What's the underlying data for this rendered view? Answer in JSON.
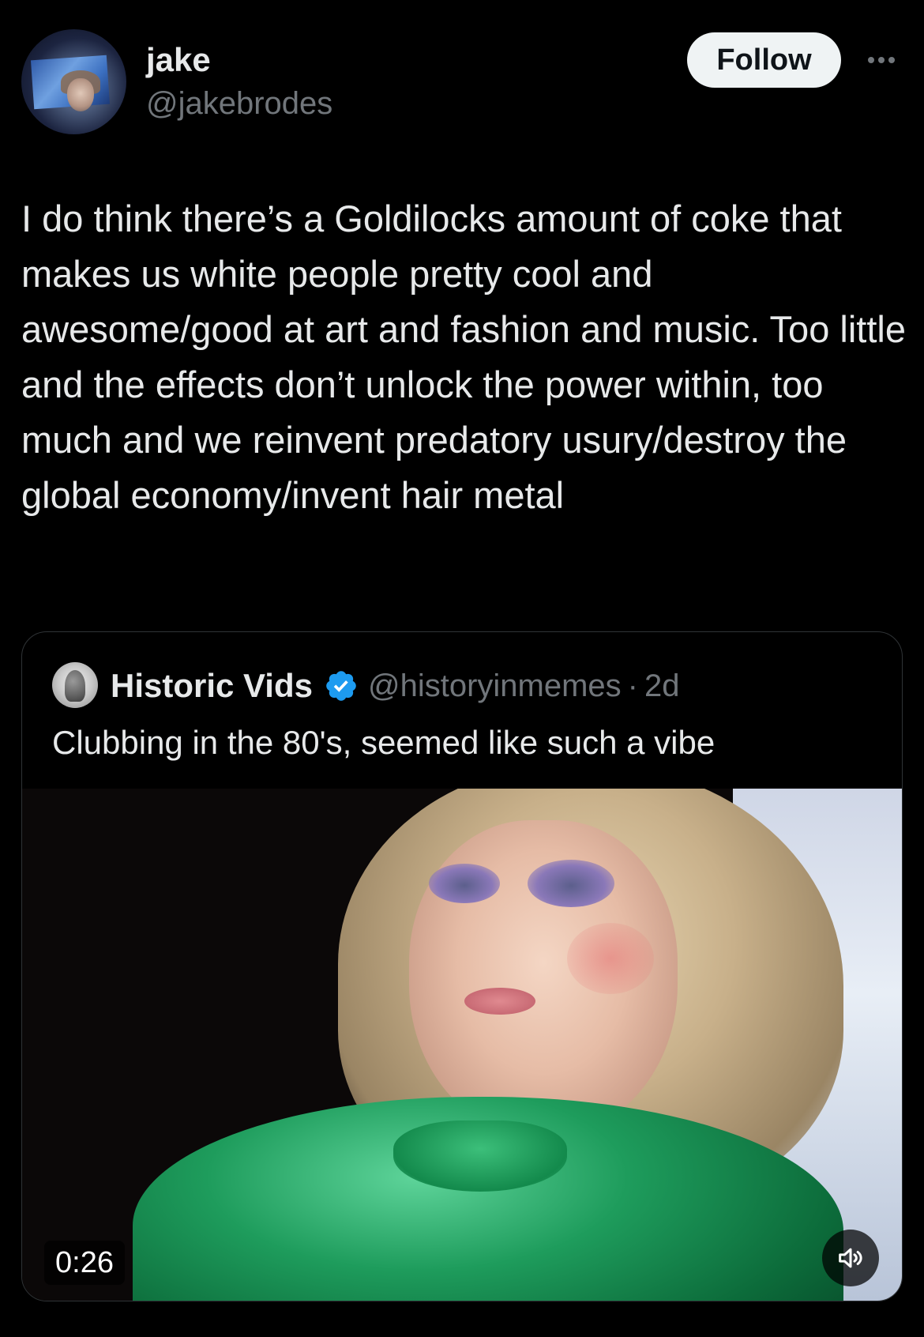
{
  "author": {
    "display_name": "jake",
    "handle": "@jakebrodes",
    "avatar_icon": "user-avatar"
  },
  "actions": {
    "follow_label": "Follow",
    "more_icon": "more-horizontal-icon"
  },
  "tweet": {
    "text": "I do think there’s a Goldilocks amount of coke that makes us white people pretty cool and awesome/good at art and fashion and music. Too little and the effects don’t unlock the power within, too much and we reinvent predatory usury/destroy the global economy/invent hair metal"
  },
  "quoted_tweet": {
    "display_name": "Historic Vids",
    "verified_icon": "verified-badge-icon",
    "verified_color": "#1d9bf0",
    "handle": "@historyinmemes",
    "separator": "·",
    "time_ago": "2d",
    "text": "Clubbing in the 80's, seemed like such a vibe",
    "video": {
      "duration": "0:26",
      "volume_icon": "volume-muted-icon"
    }
  },
  "colors": {
    "background": "#000000",
    "primary_text": "#e7e9ea",
    "secondary_text": "#71767b",
    "border": "#2f3336",
    "follow_button_bg": "#eff3f4",
    "follow_button_text": "#0f1419"
  }
}
